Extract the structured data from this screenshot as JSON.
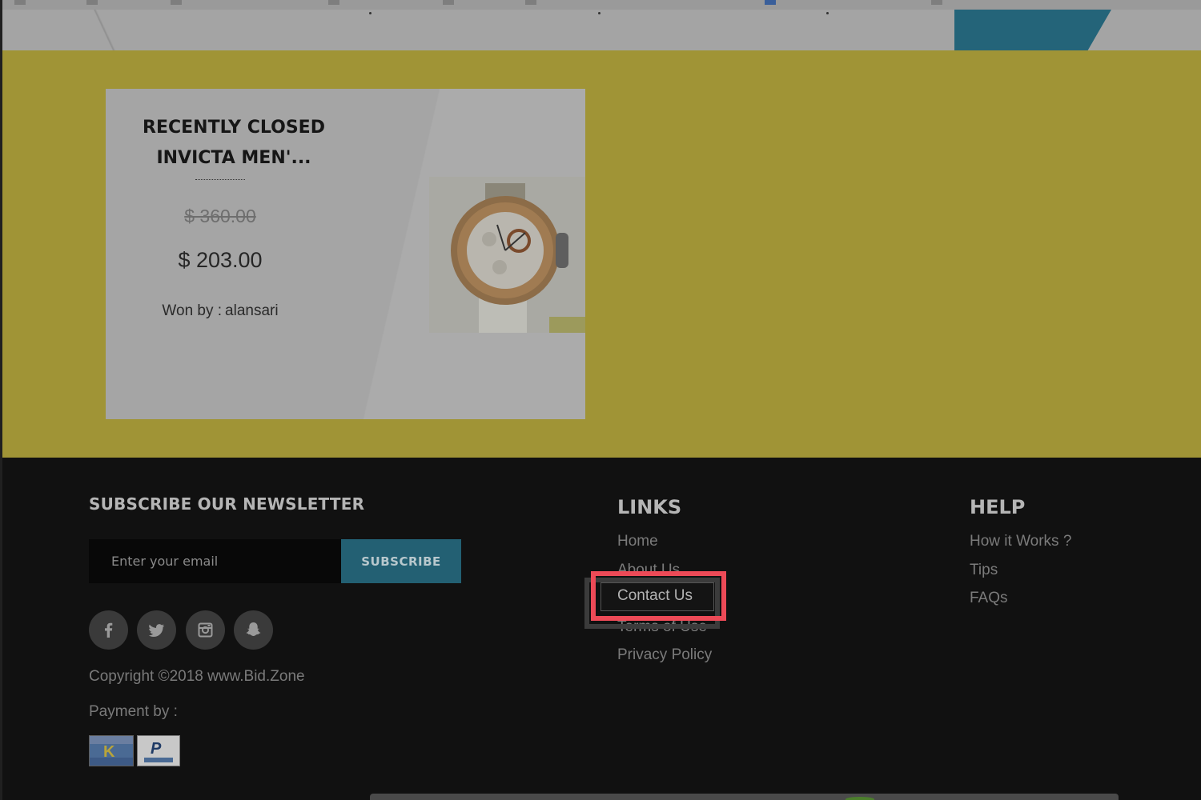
{
  "card": {
    "title_line1": "RECENTLY CLOSED",
    "title_line2": "INVICTA MEN'...",
    "old_price": "$ 360.00",
    "new_price": "$ 203.00",
    "won_by_label": "Won by :",
    "winner": "alansari"
  },
  "footer": {
    "newsletter_title": "SUBSCRIBE OUR NEWSLETTER",
    "email_placeholder": "Enter your email",
    "subscribe_label": "SUBSCRIBE",
    "social_icons": [
      "facebook-icon",
      "twitter-icon",
      "instagram-icon",
      "snapchat-icon"
    ],
    "copyright": "Copyright ©2018 www.Bid.Zone",
    "payment_label": "Payment by :",
    "links_title": "LINKS",
    "links": [
      "Home",
      "About Us",
      "Contact Us",
      "Terms of Use",
      "Privacy Policy"
    ],
    "help_title": "HELP",
    "help": [
      "How it Works ?",
      "Tips",
      "FAQs"
    ]
  },
  "colors": {
    "band": "#a09436",
    "footer": "#111111",
    "accent": "#236073",
    "highlight": "#ed4a57"
  }
}
